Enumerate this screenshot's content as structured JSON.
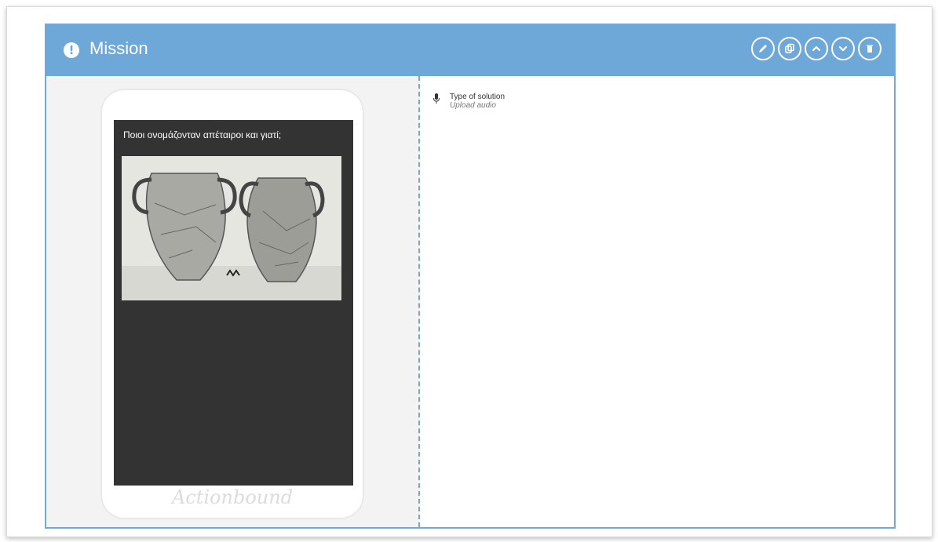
{
  "mission": {
    "title": "Mission",
    "actions": [
      {
        "name": "edit-button",
        "icon": "pencil-icon"
      },
      {
        "name": "copy-button",
        "icon": "copy-icon"
      },
      {
        "name": "move-up-button",
        "icon": "chevron-up-icon"
      },
      {
        "name": "move-down-button",
        "icon": "chevron-down-icon"
      },
      {
        "name": "delete-button",
        "icon": "trash-icon"
      }
    ]
  },
  "preview": {
    "question": "Ποιοι ονομάζονταν απέταιροι και γιατί;",
    "brand": "Actionbound"
  },
  "solution": {
    "type_label": "Type of solution",
    "type_value": "Upload audio",
    "icon": "microphone-icon"
  },
  "colors": {
    "header": "#6ea8d9",
    "border": "#6fa9dc",
    "screen": "#333333"
  }
}
